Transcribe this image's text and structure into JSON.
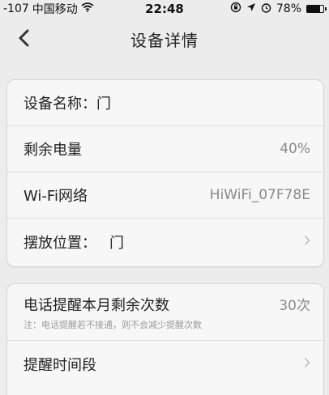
{
  "status_bar": {
    "signal": "-107",
    "carrier": "中国移动",
    "time": "22:48",
    "battery": "78%",
    "battery_level": 0.78
  },
  "nav": {
    "title": "设备详情"
  },
  "device_card": {
    "name_label": "设备名称：",
    "name_value": "门",
    "battery_label": "剩余电量",
    "battery_value": "40%",
    "wifi_label": "Wi-Fi网络",
    "wifi_value": "HiWiFi_07F78E",
    "location_label": "摆放位置：",
    "location_value": "门"
  },
  "reminder_card": {
    "remaining_label": "电话提醒本月剩余次数",
    "remaining_value": "30次",
    "note": "注：电话提醒若不接通，则不会减少提醒次数",
    "period_label": "提醒时间段"
  },
  "icons": {
    "wifi": "wifi-icon",
    "lock_rotation": "rotation-lock-icon",
    "location": "location-arrow-icon",
    "alarm": "alarm-icon",
    "back": "chevron-left-icon",
    "chevron": "chevron-right-icon"
  }
}
